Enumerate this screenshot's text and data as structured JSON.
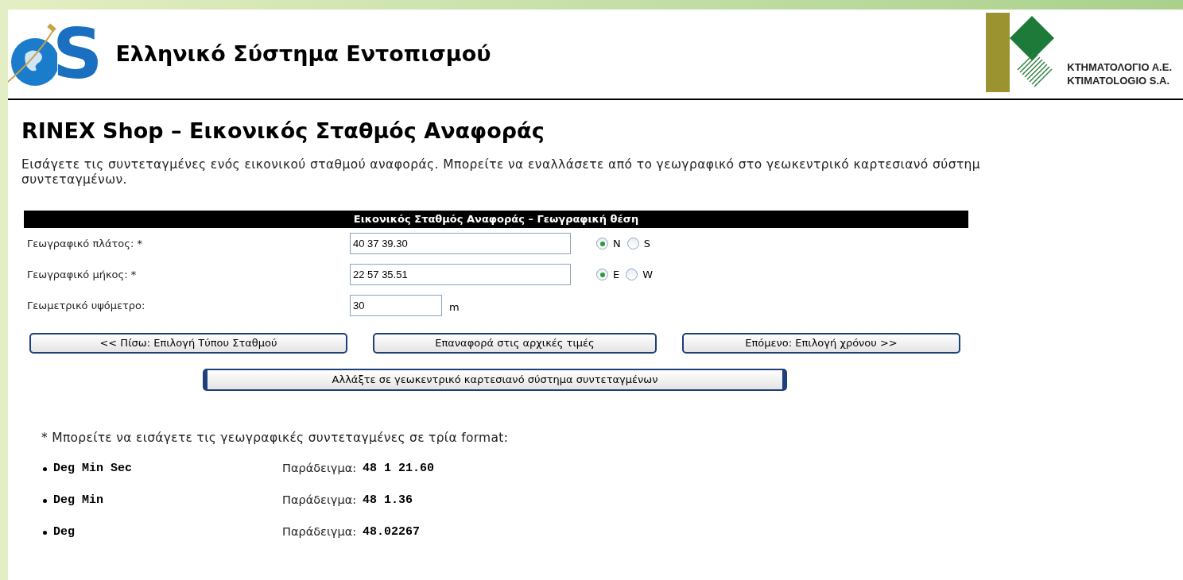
{
  "header": {
    "logo_letter": "S",
    "site_title": "Ελληνικό Σύστημα Εντοπισμού",
    "partner_logo_lines": [
      "ΚΤΗΜΑΤΟΛΟΓΙΟ Α.Ε.",
      "KTIMATOLOGIO S.A."
    ]
  },
  "page_title": "RINEX Shop – Εικονικός Σταθμός Αναφοράς",
  "intro_lines": [
    "Εισάγετε τις συντεταγμένες ενός εικονικού σταθμού αναφοράς. Μπορείτε να εναλλάσετε από το γεωγραφικό στο γεωκεντρικό καρτεσιανό σύστημ",
    "συντεταγμένων."
  ],
  "form": {
    "title": "Εικονικός Σταθμός Αναφοράς – Γεωγραφική θέση",
    "rows": [
      {
        "kind": "radio",
        "label": "Γεωγραφικό πλάτος: *",
        "value": "40 37 39.30",
        "options": [
          {
            "label": "N",
            "selected": true
          },
          {
            "label": "S",
            "selected": false
          }
        ]
      },
      {
        "kind": "radio",
        "label": "Γεωγραφικό μήκος: *",
        "value": "22 57 35.51",
        "options": [
          {
            "label": "E",
            "selected": true
          },
          {
            "label": "W",
            "selected": false
          }
        ]
      },
      {
        "kind": "unit",
        "label": "Γεωμετρικό υψόμετρο:",
        "value": "30",
        "unit": "m"
      }
    ],
    "buttons": [
      "<< Πίσω: Επιλογή Τύπου Σταθμού",
      "Επαναφορά στις αρχικές τιμές",
      "Επόμενο: Επιλογή χρόνου >>"
    ],
    "switch_button": "Αλλάξτε σε γεωκεντρικό καρτεσιανό σύστημα συντεταγμένων"
  },
  "note": "* Μπορείτε να εισάγετε τις γεωγραφικές συντεταγμένες σε τρία format:",
  "formats": [
    {
      "name": "Deg Min Sec",
      "example_label": "Παράδειγμα:",
      "example": "48 1 21.60"
    },
    {
      "name": "Deg Min",
      "example_label": "Παράδειγμα:",
      "example": "48 1.36"
    },
    {
      "name": "Deg",
      "example_label": "Παράδειγμα:",
      "example": "48.02267"
    }
  ]
}
